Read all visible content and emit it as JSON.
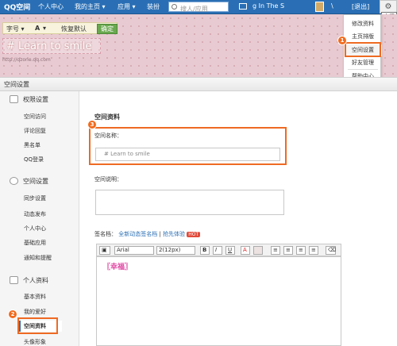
{
  "topbar": {
    "logo": "QQ空间",
    "nav": [
      "个人中心",
      "我的主页 ▾",
      "应用 ▾",
      "装扮"
    ],
    "search_placeholder": "搜人/应用",
    "user_name": "g In The S",
    "account": "\\",
    "logout": "[退出]"
  },
  "dropdown": {
    "items": [
      "修改资料",
      "主页排版",
      "空间设置",
      "好友管理",
      "帮助中心"
    ]
  },
  "site_button": "空间",
  "banner": {
    "toolbar": {
      "font_size_label": "字号 ▾",
      "font_color_label": "A",
      "restore_default": "恢复默认",
      "confirm": "确定"
    },
    "title": "# Learn to smile",
    "url": "http://qzone.qq.com"
  },
  "section_header": "空间设置",
  "sidebar": {
    "groups": [
      "权限设置",
      "空间设置",
      "个人资料"
    ],
    "items": {
      "permissions": [
        "空间访问",
        "评论回复",
        "黑名单",
        "QQ登录"
      ],
      "space": [
        "同步设置",
        "动态发布",
        "个人中心",
        "基础应用",
        "通知和提醒"
      ],
      "profile": [
        "基本资料",
        "我的爱好",
        "空间资料",
        "头像形象"
      ]
    }
  },
  "main": {
    "heading": "空间资料",
    "name_label": "空间名称：",
    "name_value": "# Learn to smile",
    "desc_label": "空间说明：",
    "signature_label": "签名档：",
    "signature_link1": "全新动态签名档",
    "signature_link2": "抢先体验",
    "hot_badge": "HOT"
  },
  "editor": {
    "font_name": "Arial",
    "font_size": "2(12px)",
    "bold": "B",
    "italic": "I",
    "underline": "U",
    "color": "A",
    "content": "〖幸福〗"
  },
  "badges": [
    "1",
    "2",
    "3"
  ],
  "colors": {
    "topbar": "#2a6fb5",
    "highlight": "#ee6a22",
    "banner": "#e8cbd2",
    "link": "#2a6fb5"
  }
}
